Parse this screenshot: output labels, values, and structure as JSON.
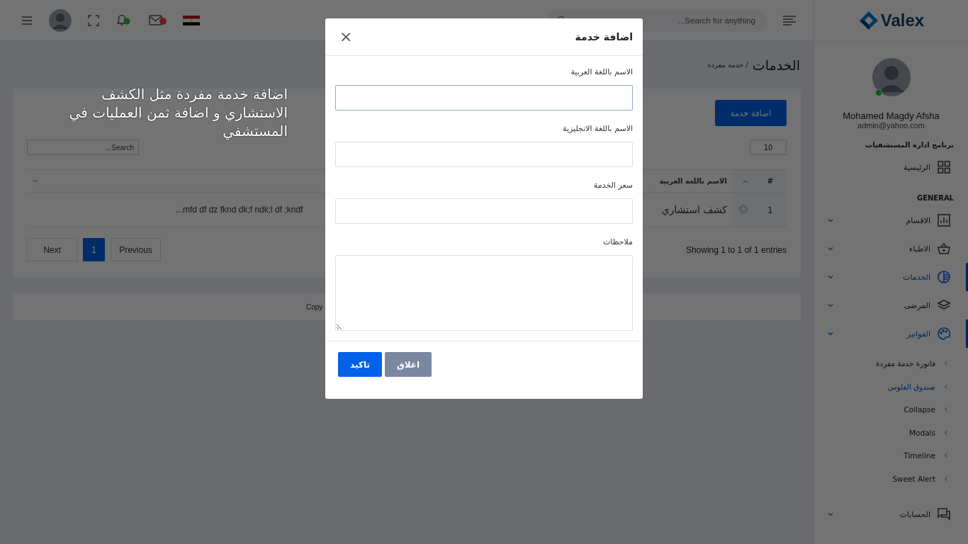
{
  "header": {
    "search": {
      "placeholder": "Search for anything..."
    }
  },
  "sidebar": {
    "logo": "Valex",
    "user": {
      "name": "Mohamed Magdy Afsha",
      "email": "admin@yahoo.com",
      "online": true
    },
    "sections": [
      {
        "heading": "برنامج ادارة المستشفيات",
        "items": [
          {
            "label": "الرئيسية",
            "selected": false
          }
        ]
      },
      {
        "heading": "GENERAL",
        "items": [
          {
            "label": "الاقسام",
            "selected": false,
            "expanded": false
          },
          {
            "label": "الاطباء",
            "selected": false,
            "expanded": false
          },
          {
            "label": "الخدمات",
            "selected": true,
            "expanded": false
          },
          {
            "label": "المرضى",
            "selected": false,
            "expanded": false
          },
          {
            "label": "الفواتير",
            "selected": true,
            "expanded": true,
            "children": [
              {
                "label": "فاتورة خدمة مفردة",
                "selected": false
              },
              {
                "label": "صندوق الفلوس",
                "selected": true
              },
              {
                "label": "Collapse",
                "selected": false
              },
              {
                "label": "Modals",
                "selected": false
              },
              {
                "label": "Timeline",
                "selected": false
              },
              {
                "label": "Sweet Alert",
                "selected": false
              }
            ]
          },
          {
            "label": "الحسابات",
            "selected": false,
            "expanded": false
          }
        ]
      }
    ]
  },
  "page": {
    "title": "الخدمات",
    "breadcrumb": "/ خدمة مفردة",
    "add_button": "اضافة خدمة",
    "page_length": "10",
    "search": {
      "placeholder": "Search..."
    },
    "table": {
      "columns": [
        "#",
        "الاسم باللغة العربية"
      ],
      "rows": [
        {
          "cells": [
            "1",
            "كشف استشاري",
            "...mfd df dz fknd dk;f ndk;l df ;kndf"
          ]
        }
      ]
    },
    "info": "Showing 1 to 1 of 1 entries",
    "pagination": {
      "previous": "Previous",
      "next": "Next",
      "pages": [
        {
          "label": "1",
          "selected": true
        }
      ]
    },
    "footer": "Copy"
  },
  "annotation": "اضافة خدمة مفردة مثل الكشف الاستشاري و اضافة ثمن العمليات في المستشفي",
  "modal": {
    "title": "اضافة خدمة",
    "close": "×",
    "fields": [
      {
        "label": "الاسم باللغة العربية",
        "kind": "input",
        "focused": true
      },
      {
        "label": "الاسم باللغة الانجليزية",
        "kind": "input",
        "focused": false
      },
      {
        "label": "سعر الخدمة",
        "kind": "input",
        "focused": false
      },
      {
        "label": "ملاحظات",
        "kind": "textarea",
        "focused": false
      }
    ],
    "buttons": [
      {
        "label": "اغلاق",
        "kind": "secondary"
      },
      {
        "label": "تاكيد",
        "kind": "primary"
      }
    ]
  }
}
